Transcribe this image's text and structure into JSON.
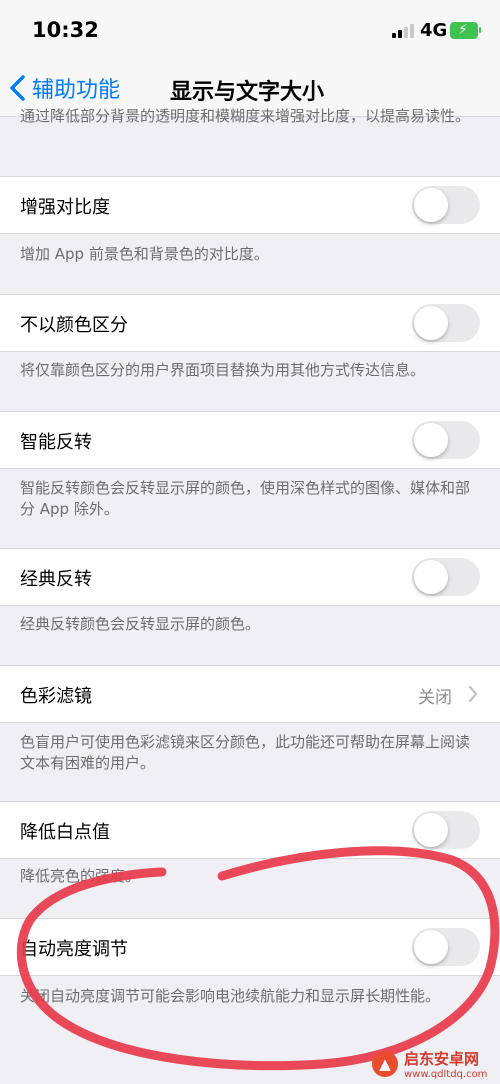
{
  "status": {
    "time": "10:32",
    "network": "4G"
  },
  "nav": {
    "back_label": "辅助功能",
    "title": "显示与文字大小"
  },
  "top_caption": "通过降低部分背景的透明度和模糊度来增强对比度，以提高易读性。",
  "rows": [
    {
      "label": "增强对比度",
      "caption": "增加 App 前景色和背景色的对比度。"
    },
    {
      "label": "不以颜色区分",
      "caption": "将仅靠颜色区分的用户界面项目替换为用其他方式传达信息。"
    },
    {
      "label": "智能反转",
      "caption": "智能反转颜色会反转显示屏的颜色，使用深色样式的图像、媒体和部分 App 除外。"
    },
    {
      "label": "经典反转",
      "caption": "经典反转颜色会反转显示屏的颜色。"
    },
    {
      "label": "色彩滤镜",
      "value": "关闭",
      "caption": "色盲用户可使用色彩滤镜来区分颜色，此功能还可帮助在屏幕上阅读文本有困难的用户。"
    },
    {
      "label": "降低白点值",
      "caption": "降低亮色的强度。"
    },
    {
      "label": "自动亮度调节",
      "caption": "关闭自动亮度调节可能会影响电池续航能力和显示屏长期性能。"
    }
  ],
  "toggles": {
    "increase_contrast": false,
    "differentiate_without_color": false,
    "smart_invert": false,
    "classic_invert": false,
    "reduce_white_point": false,
    "auto_brightness": false
  },
  "watermark": {
    "name": "启东安卓网",
    "url": "www.qdltdq.com"
  },
  "colors": {
    "accent": "#007aff",
    "annotation": "#e83a4a",
    "background": "#efeff4"
  }
}
